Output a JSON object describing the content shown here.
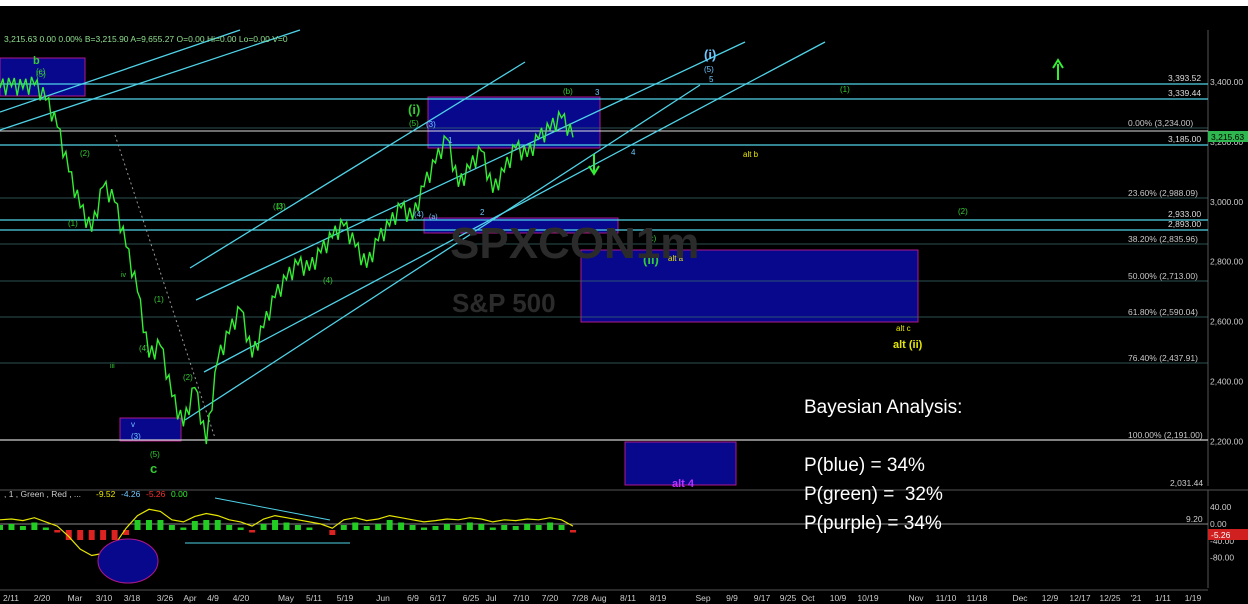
{
  "header": {
    "readout": "3,215.63  0.00  0.00%  B=3,215.90  A=9,655.27  O=0.00  Hi=0.00  Lo=0.00  V=0"
  },
  "watermark": {
    "symbol": "SPXCON1m",
    "name": "S&P 500"
  },
  "bayes": {
    "title": "Bayesian Analysis:",
    "lines": [
      "P(blue) = 34%",
      "P(green) =  32%",
      "P(purple) = 34%"
    ]
  },
  "colors": {
    "background": "#000000",
    "price": "#33ee33",
    "channel": "#4fd3e8",
    "box_fill": "#08088c",
    "box_border": "#b0188a",
    "fib_label": "#c8c8c8",
    "yellow": "#e6e600",
    "green_label": "#33cc33",
    "blue_label": "#6fc6ff"
  },
  "chart_data": [
    {
      "type": "line",
      "title": "",
      "x_ticks": [
        "2/11",
        "2/20",
        "Mar",
        "3/10",
        "3/18",
        "3/26",
        "Apr",
        "4/9",
        "4/20",
        "May",
        "5/11",
        "5/19",
        "Jun",
        "6/9",
        "6/17",
        "6/25",
        "Jul",
        "7/10",
        "7/20",
        "7/28",
        "Aug",
        "8/11",
        "8/19",
        "Sep",
        "9/9",
        "9/17",
        "9/25",
        "Oct",
        "10/9",
        "10/19",
        "Nov",
        "11/10",
        "11/18",
        "Dec",
        "12/9",
        "12/17",
        "12/25",
        "'21",
        "1/11",
        "1/19"
      ],
      "y_ticks": [
        "3,400.00",
        "3,200.00",
        "3,000.00",
        "2,800.00",
        "2,600.00",
        "2,400.00",
        "2,200.00"
      ],
      "ylim": [
        2040,
        3500
      ],
      "price_label": "3,215.63",
      "series": [
        {
          "values": [
            3380,
            3385,
            3378,
            3390,
            3340,
            3250,
            3100,
            2980,
            2900,
            3050,
            3000,
            2850,
            2700,
            2480,
            2520,
            2350,
            2250,
            2380,
            2191,
            2470,
            2560,
            2640,
            2480,
            2580,
            2680,
            2740,
            2790,
            2770,
            2830,
            2880,
            2920,
            2850,
            2780,
            2870,
            2920,
            2980,
            2940,
            3050,
            3130,
            3210,
            3050,
            3110,
            3170,
            3030,
            3100,
            3180,
            3150,
            3210,
            3240,
            3280,
            3215
          ]
        }
      ],
      "horizontal_levels": [
        {
          "value": 3393.52,
          "label": "3,393.52"
        },
        {
          "value": 3339.44,
          "label": "3,339.44"
        },
        {
          "value": 3185.0,
          "label": "3,185.00"
        },
        {
          "value": 2933.0,
          "label": "2,933.00"
        },
        {
          "value": 2893.0,
          "label": "2,893.00"
        }
      ],
      "fib_levels": [
        {
          "value": 3230,
          "label": "0.00% (3,234.00)"
        },
        {
          "value": 2988.09,
          "label": "23.60% (2,988.09)"
        },
        {
          "value": 2835.96,
          "label": "38.20% (2,835.96)"
        },
        {
          "value": 2713.0,
          "label": "50.00% (2,713.00)"
        },
        {
          "value": 2590.04,
          "label": "61.80% (2,590.04)"
        },
        {
          "value": 2437.91,
          "label": "76.40% (2,437.91)"
        },
        {
          "value": 2191,
          "label": "100.00% (2,191.00)"
        }
      ],
      "extra_level_label": "2,031.44",
      "wave_labels": [
        "b",
        "(5)",
        "(c)",
        "(1)",
        "(2)",
        "iv",
        "(1)",
        "(4)",
        "(3)",
        "iii",
        "v",
        "(5)",
        "c",
        "(1)",
        "(2)",
        "(3)",
        "(4)",
        "(5)",
        "(i)",
        "(3)",
        "(4)",
        "(a)",
        "1",
        "2",
        "(b)",
        "3",
        "4",
        "(c)",
        "(ii)",
        "alt a",
        "(i)",
        "(5)",
        "5",
        "(1)",
        "(2)",
        "alt b",
        "alt c",
        "alt (ii)",
        "alt 4"
      ]
    },
    {
      "type": "line",
      "title": "",
      "legend": ", 1 , Green , Red , ...",
      "values_readout": [
        "-9.52",
        "-4.26",
        "-5.26",
        "0.00"
      ],
      "y_ticks": [
        "40.00",
        "0.00",
        "-40.00",
        "-80.00"
      ],
      "ylim": [
        -95,
        50
      ],
      "level_label": "9.20",
      "current_label": "-5.26",
      "series": [
        {
          "values": [
            10,
            12,
            8,
            15,
            5,
            -5,
            -30,
            -60,
            -75,
            -70,
            -50,
            -10,
            20,
            35,
            30,
            10,
            5,
            18,
            25,
            20,
            10,
            5,
            -5,
            12,
            20,
            15,
            10,
            5,
            0,
            -10,
            10,
            15,
            8,
            12,
            20,
            15,
            10,
            5,
            8,
            12,
            10,
            15,
            12,
            5,
            10,
            8,
            12,
            10,
            15,
            10,
            -5
          ]
        }
      ]
    }
  ]
}
